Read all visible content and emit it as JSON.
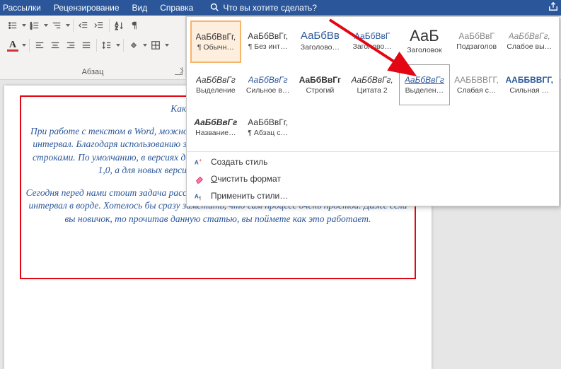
{
  "menubar": {
    "items": [
      "Рассылки",
      "Рецензирование",
      "Вид",
      "Справка"
    ],
    "search_placeholder": "Что вы хотите сделать?"
  },
  "paragraph_group_label": "Абзац",
  "styles_gallery": {
    "rows": [
      [
        {
          "preview": "АаБбВвГг,",
          "name": "¶ Обычн…",
          "sel": true,
          "pcolor": "#333",
          "bold": false
        },
        {
          "preview": "АаБбВвГг,",
          "name": "¶ Без инт…",
          "pcolor": "#333",
          "bold": false
        },
        {
          "preview": "АаБбВв",
          "name": "Заголово…",
          "pcolor": "#2b579a",
          "bold": false,
          "size": "15px"
        },
        {
          "preview": "АаБбВвГ",
          "name": "Заголово…",
          "pcolor": "#2b579a",
          "bold": false
        },
        {
          "preview": "АаБ",
          "name": "Заголовок",
          "pcolor": "#333",
          "bold": false,
          "size": "22px"
        },
        {
          "preview": "АаБбВвГ",
          "name": "Подзаголов",
          "pcolor": "#888",
          "bold": false
        },
        {
          "preview": "АаБбВвГг,",
          "name": "Слабое вы…",
          "pcolor": "#888",
          "italic": true
        }
      ],
      [
        {
          "preview": "АаБбВвГг",
          "name": "Выделение",
          "pcolor": "#333",
          "italic": true
        },
        {
          "preview": "АаБбВвГг",
          "name": "Сильное в…",
          "pcolor": "#2b579a",
          "italic": true
        },
        {
          "preview": "АаБбВвГг",
          "name": "Строгий",
          "pcolor": "#333",
          "bold": true
        },
        {
          "preview": "АаБбВвГг,",
          "name": "Цитата 2",
          "pcolor": "#333",
          "italic": true
        },
        {
          "preview": "АаБбВвГг",
          "name": "Выделен…",
          "pcolor": "#2b579a",
          "italic": true,
          "hover": true,
          "underline": true
        },
        {
          "preview": "ААББВВГГ,",
          "name": "Слабая с…",
          "pcolor": "#888",
          "caps": true
        },
        {
          "preview": "ААББВВГГ,",
          "name": "Сильная …",
          "pcolor": "#2b579a",
          "caps": true,
          "bold": true
        }
      ],
      [
        {
          "preview": "АаБбВвГг",
          "name": "Название…",
          "pcolor": "#333",
          "bold": true,
          "italic": true
        },
        {
          "preview": "АаБбВвГг,",
          "name": "¶ Абзац с…",
          "pcolor": "#333"
        }
      ]
    ],
    "menu": {
      "create": "Создать стиль",
      "clear": "Очистить формат",
      "apply": "Применить стили…"
    }
  },
  "document": {
    "title_line": "Как изменить межстр",
    "p1": "При работе с текстом в Word, можно встретиться с таким понятием, как межстрочный интервал. Благодаря использованию этой функции, можно настроить расстояние между строками. По умолчанию, в версиях до MS Word 2003 межстрочный интервал составляет 1,0, а для новых версий установлено значение 1,15 строки.",
    "p2": "Сегодня перед нами стоит задача рассказать читателю о том, как изменить межстрочный интервал в ворде. Хотелось бы сразу заметить, что сам процесс очень простой. Даже если вы новичок, то прочитав данную статью, вы поймете как это работает."
  }
}
